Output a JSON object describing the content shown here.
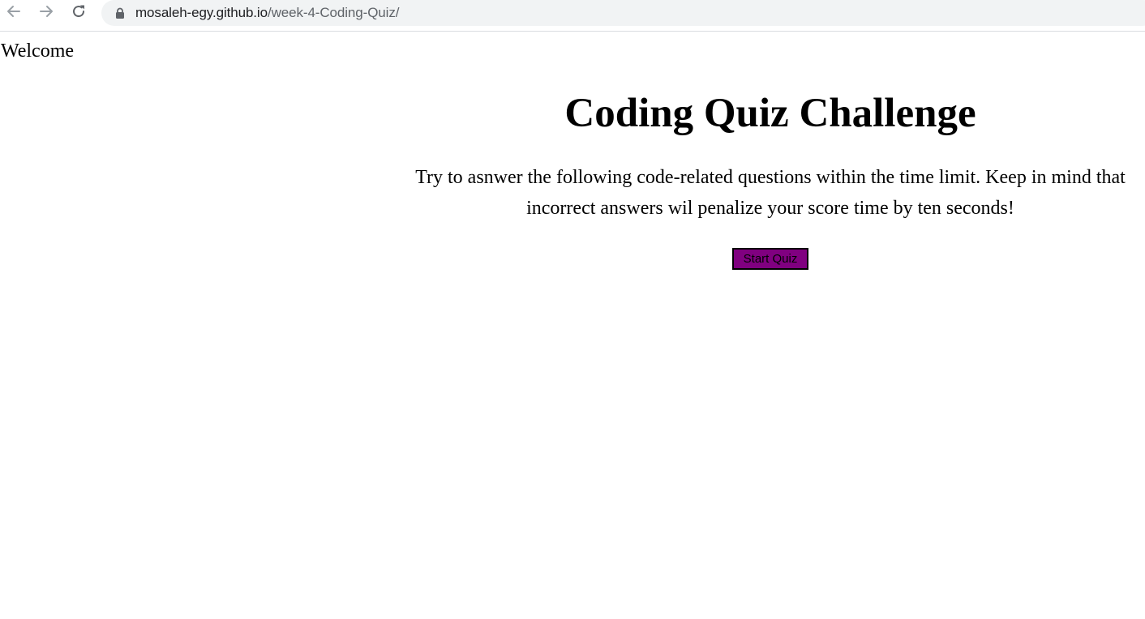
{
  "browser": {
    "url_host": "mosaleh-egy.github.io",
    "url_path": "/week-4-Coding-Quiz/",
    "icons": {
      "back": "arrow-left-icon",
      "forward": "arrow-right-icon",
      "reload": "reload-icon",
      "lock": "lock-icon"
    }
  },
  "page": {
    "welcome": "Welcome",
    "title": "Coding Quiz Challenge",
    "description": "Try to asnwer the following code-related questions within the time limit. Keep in mind that incorrect answers wil penalize your score time by ten seconds!",
    "start_button_label": "Start Quiz"
  },
  "colors": {
    "start_button_bg": "#800080",
    "omnibox_bg": "#f1f3f4"
  }
}
